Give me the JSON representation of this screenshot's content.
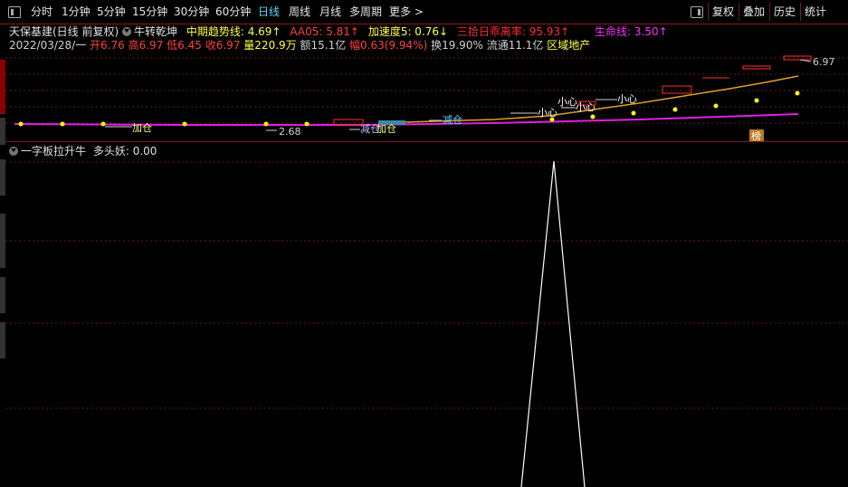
{
  "toolbar": {
    "periods": [
      "分时",
      "1分钟",
      "5分钟",
      "15分钟",
      "30分钟",
      "60分钟",
      "日线",
      "周线",
      "月线",
      "多周期",
      "更多 >"
    ],
    "active_period": "日线",
    "right_buttons": [
      "复权",
      "叠加",
      "历史",
      "统计"
    ]
  },
  "info1": {
    "stock": "天保基建(日线 前复权)",
    "indicator": "牛转乾坤",
    "mid_trend": "中期趋势线: 4.69↑",
    "aa05": "AA05: 5.81↑",
    "accel": "加速度5: 0.76↓",
    "bias": "三拾日乖离率: 95.93↑",
    "life": "生命线: 3.50↑"
  },
  "info2": {
    "date": "2022/03/28/一",
    "open": "开6.76",
    "high": "高6.97",
    "low": "低6.45",
    "close": "收6.97",
    "volume": "量220.9万",
    "amount": "额15.1亿",
    "change": "幅0.63(9.94%)",
    "turnover": "换19.90%",
    "float": "流通11.1亿",
    "sector": "区域地产"
  },
  "chart_labels": {
    "high_label": "6.97",
    "low_label": "2.68",
    "annotations": [
      "加仓",
      "减仓",
      "小心",
      "小心",
      "加仓",
      "减仓",
      "小心",
      "小心",
      "榜"
    ]
  },
  "lower": {
    "title": "一字板拉升牛",
    "indicator": "多头妖: 0.00"
  },
  "colors": {
    "accent_red": "#ff3b3b",
    "trend_orange": "#e0a020",
    "life_magenta": "#e020e0",
    "dot_yellow": "#ffff00",
    "active_cyan": "#5fd7ff"
  }
}
